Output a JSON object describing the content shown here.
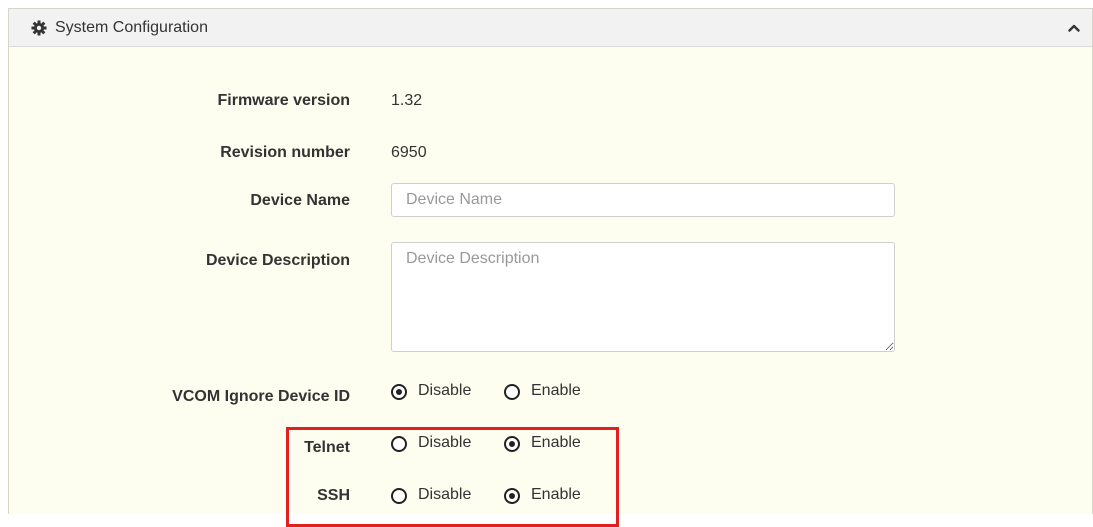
{
  "header": {
    "title": "System Configuration",
    "icon": "gear-icon",
    "collapse_icon": "chevron-up-icon"
  },
  "fields": {
    "firmware": {
      "label": "Firmware version",
      "value": "1.32"
    },
    "revision": {
      "label": "Revision number",
      "value": "6950"
    },
    "device_name": {
      "label": "Device Name",
      "value": "",
      "placeholder": "Device Name"
    },
    "device_description": {
      "label": "Device Description",
      "value": "",
      "placeholder": "Device Description"
    },
    "vcom_ignore": {
      "label": "VCOM Ignore Device ID",
      "options": [
        {
          "label": "Disable",
          "checked": true
        },
        {
          "label": "Enable",
          "checked": false
        }
      ]
    },
    "telnet": {
      "label": "Telnet",
      "options": [
        {
          "label": "Disable",
          "checked": false
        },
        {
          "label": "Enable",
          "checked": true
        }
      ]
    },
    "ssh": {
      "label": "SSH",
      "options": [
        {
          "label": "Disable",
          "checked": false
        },
        {
          "label": "Enable",
          "checked": true
        }
      ]
    }
  },
  "colors": {
    "panel_background": "#fdfdf0",
    "highlight_border": "#e02020"
  }
}
